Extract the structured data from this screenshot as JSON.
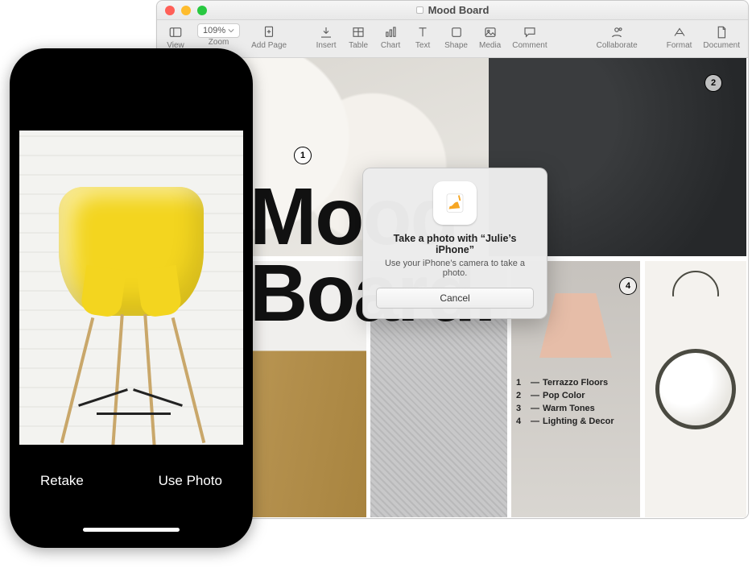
{
  "window": {
    "title": "Mood Board"
  },
  "toolbar": {
    "view": "View",
    "zoom_value": "109%",
    "zoom": "Zoom",
    "add_page": "Add Page",
    "insert": "Insert",
    "table": "Table",
    "chart": "Chart",
    "text": "Text",
    "shape": "Shape",
    "media": "Media",
    "comment": "Comment",
    "collaborate": "Collaborate",
    "format": "Format",
    "document": "Document"
  },
  "canvas": {
    "headline_line1": "Mood",
    "headline_line2": "Board.",
    "markers": {
      "m1": "1",
      "m2": "2",
      "m4": "4"
    },
    "legend": {
      "1": "Terrazzo Floors",
      "2": "Pop Color",
      "3": "Warm Tones",
      "4": "Lighting & Decor"
    }
  },
  "dialog": {
    "title": "Take a photo with “Julie’s iPhone”",
    "subtitle": "Use your iPhone’s camera to take a photo.",
    "cancel": "Cancel"
  },
  "iphone": {
    "retake": "Retake",
    "use_photo": "Use Photo"
  }
}
